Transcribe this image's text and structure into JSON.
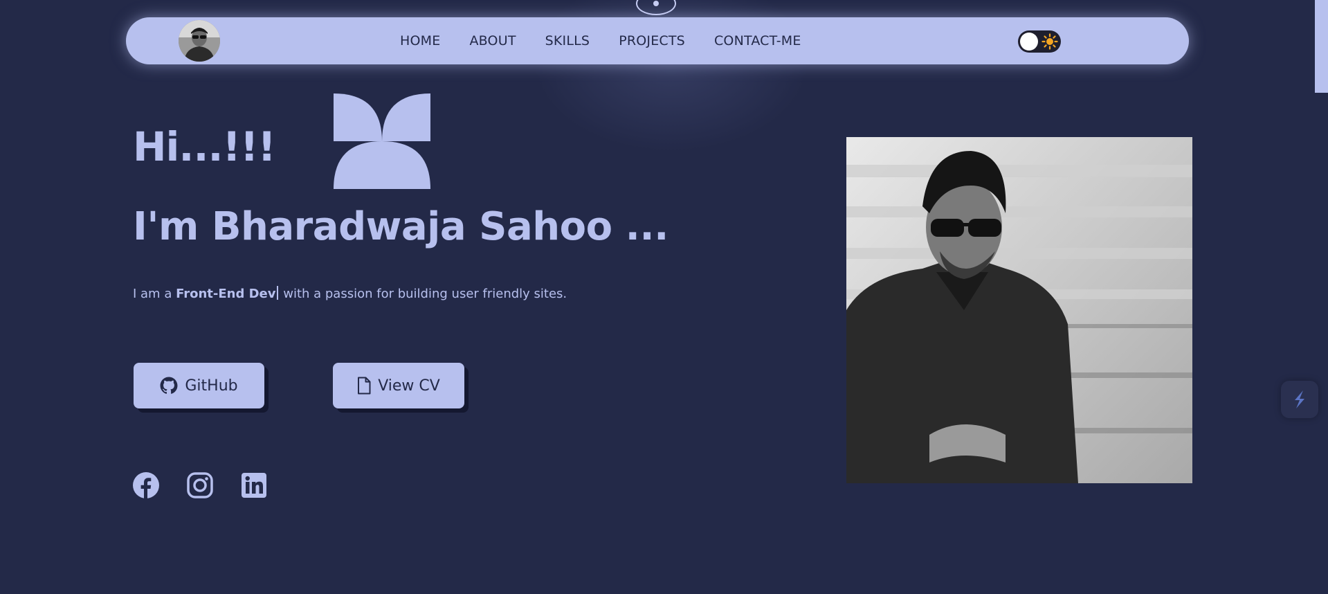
{
  "nav": {
    "avatar_alt": "profile avatar",
    "links": [
      "HOME",
      "ABOUT",
      "SKILLS",
      "PROJECTS",
      "CONTACT-ME"
    ],
    "theme_toggle_icon": "sun-icon"
  },
  "hero": {
    "greeting": "Hi...!!!",
    "name_line": "I'm Bharadwaja Sahoo ...",
    "tagline_prefix": "I am a ",
    "tagline_role": "Front-End Dev",
    "tagline_suffix": " with a passion for building user friendly sites."
  },
  "buttons": {
    "github_label": "GitHub",
    "github_icon": "github-icon",
    "cv_label": "View CV",
    "cv_icon": "file-icon"
  },
  "socials": [
    "facebook-icon",
    "instagram-icon",
    "linkedin-icon"
  ],
  "colors": {
    "background": "#232948",
    "accent": "#b7c0ee",
    "text_dark": "#232948",
    "sun": "#f5a623"
  }
}
